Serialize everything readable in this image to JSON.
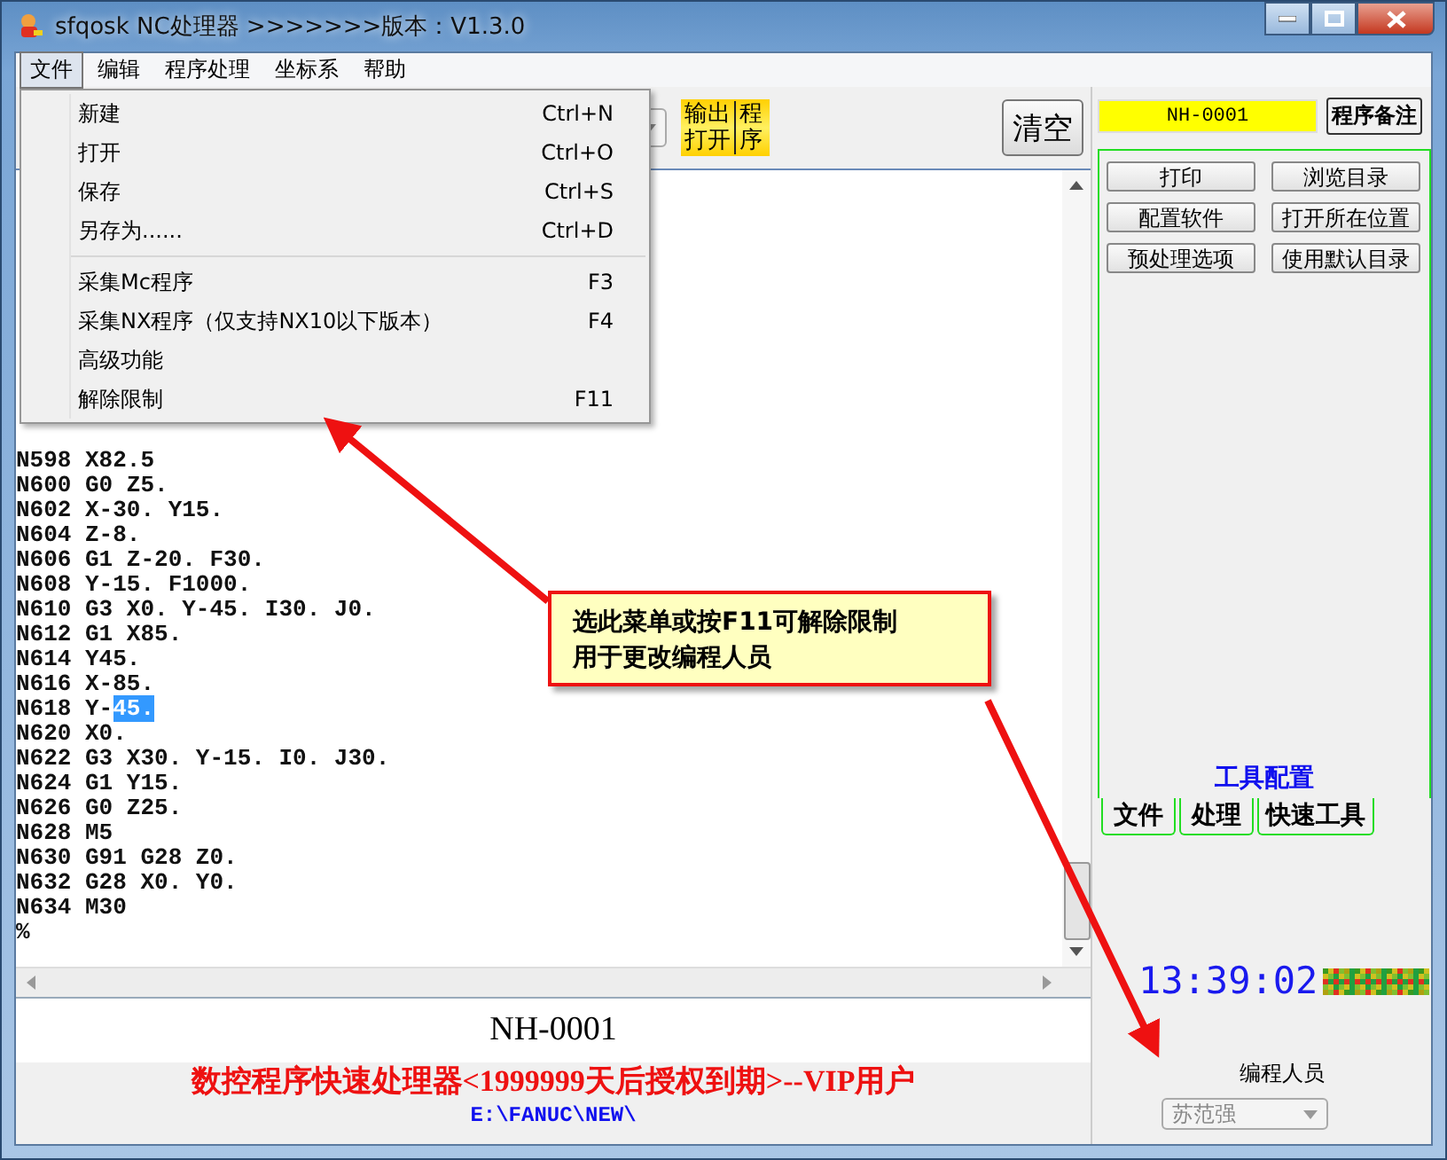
{
  "window": {
    "title": "sfqosk NC处理器 >>>>>>>版本：V1.3.0"
  },
  "menu_bar": [
    {
      "label": "文件",
      "selected": true
    },
    {
      "label": "编辑",
      "selected": false
    },
    {
      "label": "程序处理",
      "selected": false
    },
    {
      "label": "坐标系",
      "selected": false
    },
    {
      "label": "帮助",
      "selected": false
    }
  ],
  "open_menu": [
    {
      "kind": "item",
      "label": "新建",
      "shortcut": "Ctrl+N"
    },
    {
      "kind": "item",
      "label": "打开",
      "shortcut": "Ctrl+O"
    },
    {
      "kind": "item",
      "label": "保存",
      "shortcut": "Ctrl+S"
    },
    {
      "kind": "item",
      "label": "另存为......",
      "shortcut": "Ctrl+D"
    },
    {
      "kind": "separator"
    },
    {
      "kind": "item",
      "label": "采集Mc程序",
      "shortcut": "F3"
    },
    {
      "kind": "item",
      "label": "采集NX程序（仅支持NX10以下版本）",
      "shortcut": "F4"
    },
    {
      "kind": "item",
      "label": "高级功能"
    },
    {
      "kind": "item",
      "label": "解除限制",
      "shortcut": "F11"
    }
  ],
  "output_badge": {
    "left": [
      "输出",
      "打开"
    ],
    "right": [
      "程",
      "序"
    ]
  },
  "clear_button": "清空",
  "editor": {
    "lines": [
      {
        "text": "N598 X82.5"
      },
      {
        "text": "N600 G0 Z5."
      },
      {
        "text": "N602 X-30. Y15."
      },
      {
        "text": "N604 Z-8."
      },
      {
        "text": "N606 G1 Z-20. F30."
      },
      {
        "text": "N608 Y-15. F1000."
      },
      {
        "text": "N610 G3 X0. Y-45. I30. J0."
      },
      {
        "text": "N612 G1 X85."
      },
      {
        "text": "N614 Y45."
      },
      {
        "text": "N616 X-85."
      },
      {
        "text": "N618 Y-",
        "selection": "45."
      },
      {
        "text": "N620 X0."
      },
      {
        "text": "N622 G3 X30. Y-15. I0. J30."
      },
      {
        "text": "N624 G1 Y15."
      },
      {
        "text": "N626 G0 Z25."
      },
      {
        "text": "N628 M5"
      },
      {
        "text": "N630 G91 G28 Z0."
      },
      {
        "text": "N632 G28 X0. Y0."
      },
      {
        "text": "N634 M30"
      },
      {
        "text": "%"
      }
    ]
  },
  "program_name": "NH-0001",
  "license_text": "数控程序快速处理器<1999999天后授权到期>--VIP用户",
  "path": "E:\\FANUC\\NEW\\",
  "right_panel": {
    "program_number": "NH-0001",
    "note_button": "程序备注",
    "tool_buttons": [
      "打印",
      "浏览目录",
      "配置软件",
      "打开所在位置",
      "预处理选项",
      "使用默认目录"
    ],
    "tool_config_label": "工具配置",
    "tabs": [
      "文件",
      "处理",
      "快速工具"
    ],
    "clock": "13:39:02",
    "programmer": {
      "label": "编程人员",
      "value": "苏范强",
      "disabled": true
    }
  },
  "callout": {
    "lines": [
      "选此菜单或按F11可解除限制",
      "用于更改编程人员"
    ]
  }
}
